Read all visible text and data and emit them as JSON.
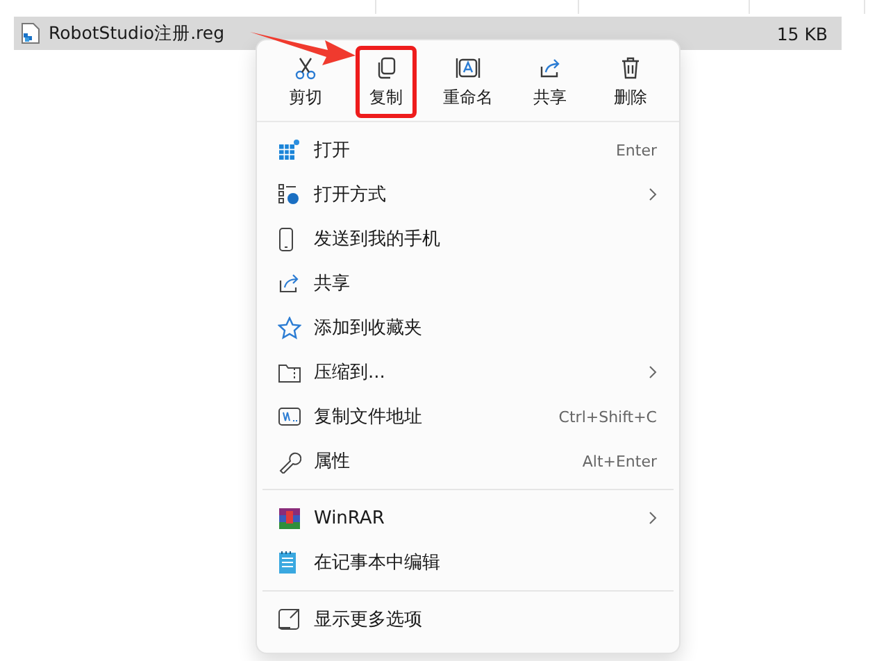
{
  "file_row": {
    "name": "RobotStudio注册.reg",
    "size": "15 KB",
    "selected": true
  },
  "quick_actions": [
    {
      "kind": "cut",
      "label": "剪切",
      "highlighted": false
    },
    {
      "kind": "copy",
      "label": "复制",
      "highlighted": true
    },
    {
      "kind": "rename",
      "label": "重命名",
      "highlighted": false
    },
    {
      "kind": "share",
      "label": "共享",
      "highlighted": false
    },
    {
      "kind": "delete",
      "label": "删除",
      "highlighted": false
    }
  ],
  "menu_groups": [
    [
      {
        "kind": "open",
        "label": "打开",
        "shortcut": "Enter",
        "submenu": false
      },
      {
        "kind": "openwith",
        "label": "打开方式",
        "submenu": true
      },
      {
        "kind": "phone",
        "label": "发送到我的手机",
        "submenu": false
      },
      {
        "kind": "share",
        "label": "共享",
        "submenu": false
      },
      {
        "kind": "star",
        "label": "添加到收藏夹",
        "submenu": false
      },
      {
        "kind": "zip",
        "label": "压缩到...",
        "submenu": true
      },
      {
        "kind": "path",
        "label": "复制文件地址",
        "shortcut": "Ctrl+Shift+C",
        "submenu": false
      },
      {
        "kind": "wrench",
        "label": "属性",
        "shortcut": "Alt+Enter",
        "submenu": false
      }
    ],
    [
      {
        "kind": "winrar",
        "label": "WinRAR",
        "submenu": true
      },
      {
        "kind": "notepad",
        "label": "在记事本中编辑",
        "submenu": false
      }
    ],
    [
      {
        "kind": "more",
        "label": "显示更多选项",
        "submenu": false
      }
    ]
  ]
}
